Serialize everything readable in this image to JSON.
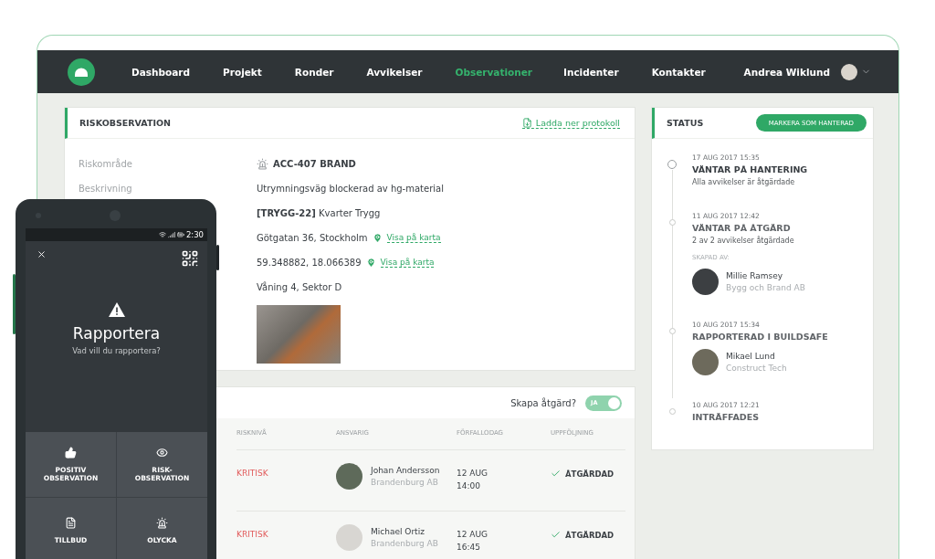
{
  "nav": {
    "items": [
      {
        "label": "Dashboard",
        "selected": false
      },
      {
        "label": "Projekt",
        "selected": false
      },
      {
        "label": "Ronder",
        "selected": false
      },
      {
        "label": "Avvikelser",
        "selected": false
      },
      {
        "label": "Observationer",
        "selected": true
      },
      {
        "label": "Incidenter",
        "selected": false
      },
      {
        "label": "Kontakter",
        "selected": false
      }
    ],
    "user": {
      "name": "Andrea Wiklund"
    }
  },
  "observation": {
    "title": "RISKOBSERVATION",
    "download": "Ladda ner protokoll",
    "fields": [
      {
        "kind": "alarm",
        "label": "Riskområde",
        "value": "ACC-407 BRAND"
      },
      {
        "kind": "text",
        "label": "Beskrivning",
        "value": "Utrymningsväg blockerad av hg-material"
      },
      {
        "kind": "text",
        "value": "**[TRYGG-22]** Kvarter Trygg"
      },
      {
        "kind": "location",
        "value": "Götgatan 36, Stockholm",
        "link": "Visa på karta"
      },
      {
        "kind": "location",
        "value": "59.348882, 18.066389",
        "link": "Visa på karta"
      },
      {
        "kind": "text",
        "value": "Våning 4, Sektor D"
      },
      {
        "kind": "photo"
      }
    ]
  },
  "actions": {
    "prompt": "Skapa åtgärd?",
    "toggle": {
      "label": "JA",
      "on": true
    },
    "columns": [
      "RISKNIVÅ",
      "ANSVARIG",
      "FÖRFALLODAG",
      "UPPFÖLJNING"
    ],
    "rows": [
      {
        "risk": "KRITISK",
        "person": "Johan Andersson",
        "company": "Brandenburg AB",
        "due_date": "12 AUG",
        "due_time": "14:00",
        "followup": "ÅTGÄRDAD"
      },
      {
        "risk": "KRITISK",
        "person": "Michael Ortiz",
        "company": "Brandenburg AB",
        "due_date": "12 AUG",
        "due_time": "16:45",
        "followup": "ÅTGÄRDAD"
      }
    ]
  },
  "status": {
    "title": "STATUS",
    "button": "MARKERA SOM HANTERAD",
    "events": [
      {
        "current": true,
        "time": "17 AUG 2017 15:35",
        "title": "VÄNTAR PÅ HANTERING",
        "subtitle": "Alla avvikelser är åtgärdade"
      },
      {
        "current": false,
        "time": "11 AUG 2017 12:42",
        "title": "VÄNTAR PÅ ÅTGÄRD",
        "subtitle": "2 av 2 avvikelser åtgärdade",
        "created_label": "SKAPAD AV:",
        "person": {
          "name": "Millie Ramsey",
          "company": "Bygg och Brand AB"
        }
      },
      {
        "current": false,
        "time": "10 AUG 2017 15:34",
        "title": "RAPPORTERAD I BUILDSAFE",
        "person": {
          "name": "Mikael Lund",
          "company": "Construct Tech"
        }
      },
      {
        "current": false,
        "time": "10 AUG 2017 12:21",
        "title": "INTRÄFFADES"
      }
    ]
  },
  "phone": {
    "time": "2:30",
    "title": "Rapportera",
    "subtitle": "Vad vill du rapportera?",
    "options": [
      {
        "kind": "thumb",
        "label": "POSITIV\nOBSERVATION"
      },
      {
        "kind": "eye",
        "label": "RISK-\nOBSERVATION"
      },
      {
        "kind": "document",
        "label": "TILLBUD"
      },
      {
        "kind": "siren",
        "label": "OLYCKA"
      }
    ]
  }
}
